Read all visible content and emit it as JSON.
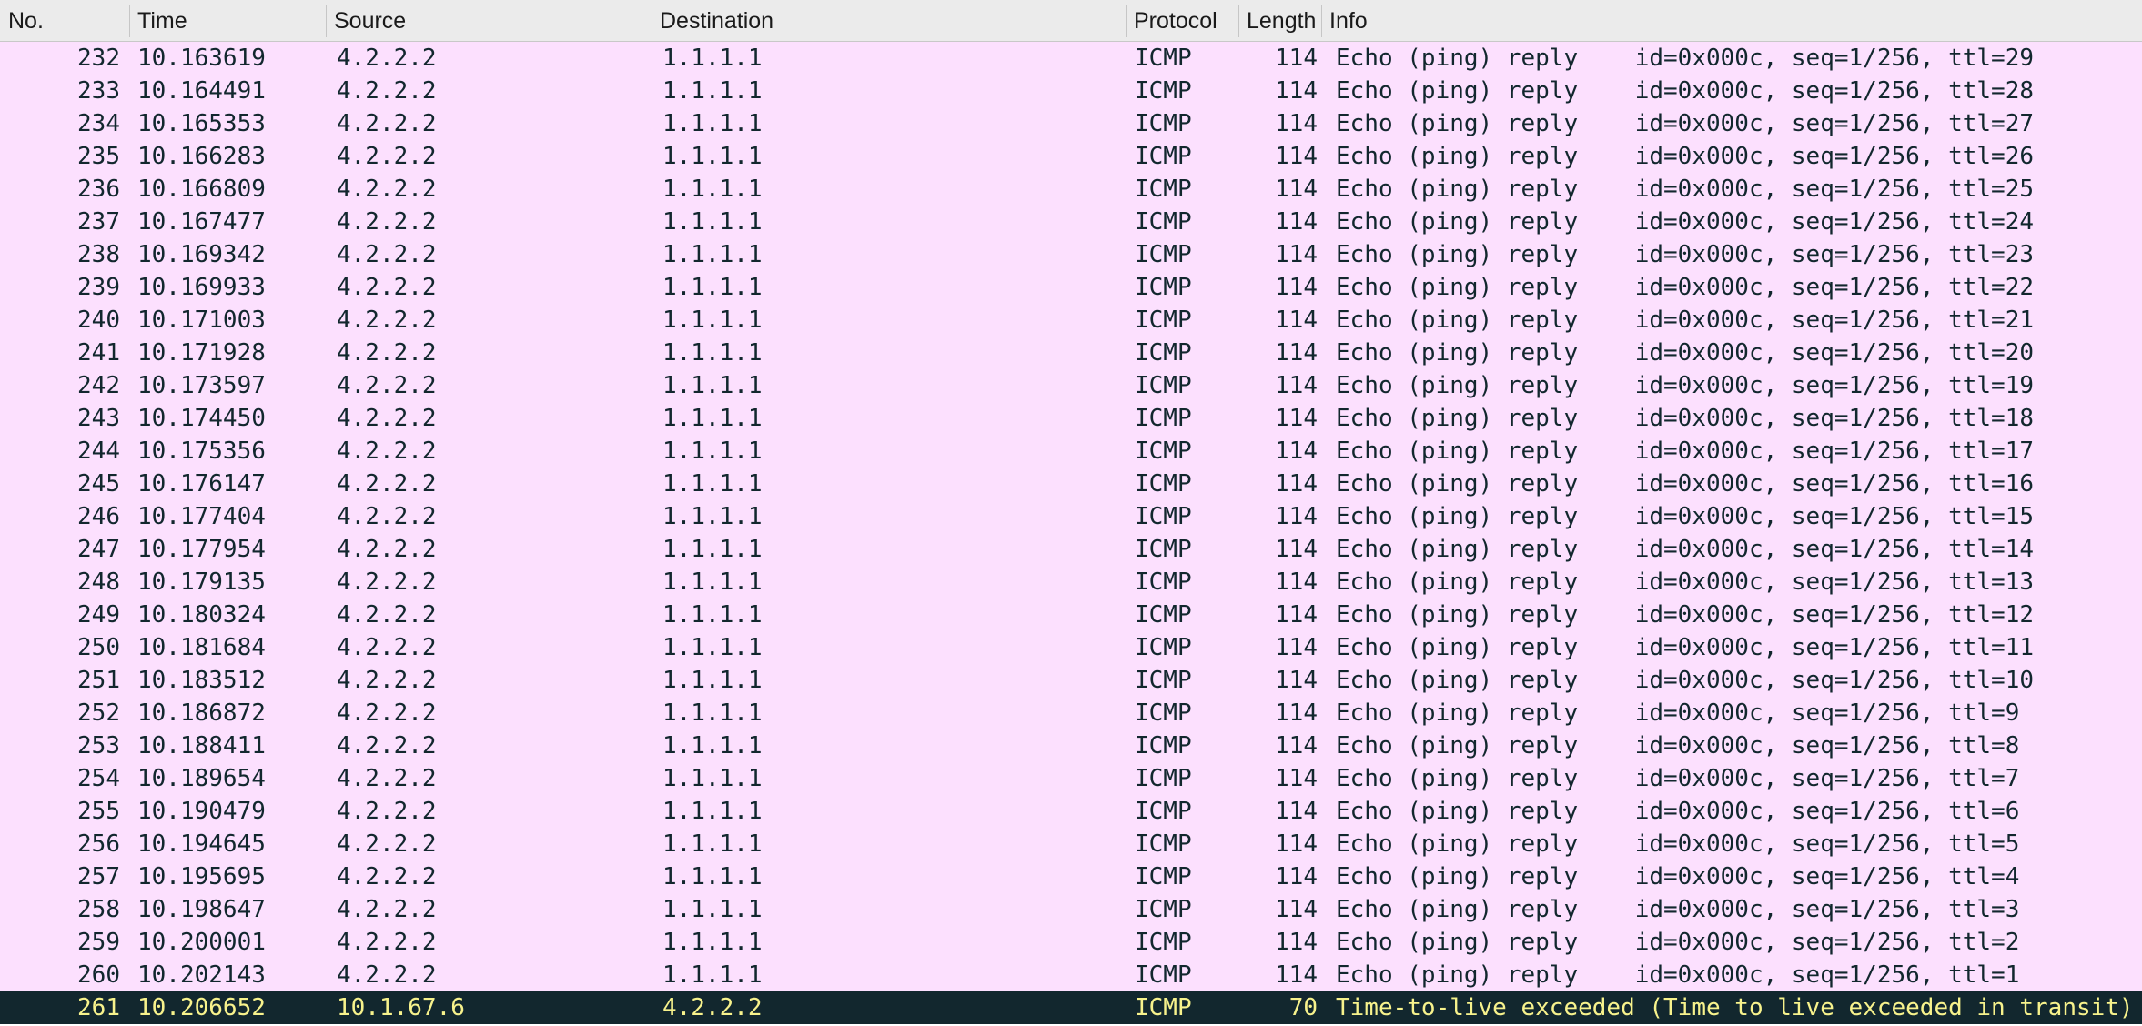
{
  "columns": {
    "no": "No.",
    "time": "Time",
    "source": "Source",
    "destination": "Destination",
    "protocol": "Protocol",
    "length": "Length",
    "info": "Info"
  },
  "colors": {
    "icmp_row_bg": "#fce0fe",
    "icmp_row_fg": "#12272e",
    "error_row_bg": "#12272e",
    "error_row_fg": "#f7f28c"
  },
  "packets": [
    {
      "no": "232",
      "time": "10.163619",
      "source": "4.2.2.2",
      "destination": "1.1.1.1",
      "protocol": "ICMP",
      "length": "114",
      "info": "Echo (ping) reply    id=0x000c, seq=1/256, ttl=29"
    },
    {
      "no": "233",
      "time": "10.164491",
      "source": "4.2.2.2",
      "destination": "1.1.1.1",
      "protocol": "ICMP",
      "length": "114",
      "info": "Echo (ping) reply    id=0x000c, seq=1/256, ttl=28"
    },
    {
      "no": "234",
      "time": "10.165353",
      "source": "4.2.2.2",
      "destination": "1.1.1.1",
      "protocol": "ICMP",
      "length": "114",
      "info": "Echo (ping) reply    id=0x000c, seq=1/256, ttl=27"
    },
    {
      "no": "235",
      "time": "10.166283",
      "source": "4.2.2.2",
      "destination": "1.1.1.1",
      "protocol": "ICMP",
      "length": "114",
      "info": "Echo (ping) reply    id=0x000c, seq=1/256, ttl=26"
    },
    {
      "no": "236",
      "time": "10.166809",
      "source": "4.2.2.2",
      "destination": "1.1.1.1",
      "protocol": "ICMP",
      "length": "114",
      "info": "Echo (ping) reply    id=0x000c, seq=1/256, ttl=25"
    },
    {
      "no": "237",
      "time": "10.167477",
      "source": "4.2.2.2",
      "destination": "1.1.1.1",
      "protocol": "ICMP",
      "length": "114",
      "info": "Echo (ping) reply    id=0x000c, seq=1/256, ttl=24"
    },
    {
      "no": "238",
      "time": "10.169342",
      "source": "4.2.2.2",
      "destination": "1.1.1.1",
      "protocol": "ICMP",
      "length": "114",
      "info": "Echo (ping) reply    id=0x000c, seq=1/256, ttl=23"
    },
    {
      "no": "239",
      "time": "10.169933",
      "source": "4.2.2.2",
      "destination": "1.1.1.1",
      "protocol": "ICMP",
      "length": "114",
      "info": "Echo (ping) reply    id=0x000c, seq=1/256, ttl=22"
    },
    {
      "no": "240",
      "time": "10.171003",
      "source": "4.2.2.2",
      "destination": "1.1.1.1",
      "protocol": "ICMP",
      "length": "114",
      "info": "Echo (ping) reply    id=0x000c, seq=1/256, ttl=21"
    },
    {
      "no": "241",
      "time": "10.171928",
      "source": "4.2.2.2",
      "destination": "1.1.1.1",
      "protocol": "ICMP",
      "length": "114",
      "info": "Echo (ping) reply    id=0x000c, seq=1/256, ttl=20"
    },
    {
      "no": "242",
      "time": "10.173597",
      "source": "4.2.2.2",
      "destination": "1.1.1.1",
      "protocol": "ICMP",
      "length": "114",
      "info": "Echo (ping) reply    id=0x000c, seq=1/256, ttl=19"
    },
    {
      "no": "243",
      "time": "10.174450",
      "source": "4.2.2.2",
      "destination": "1.1.1.1",
      "protocol": "ICMP",
      "length": "114",
      "info": "Echo (ping) reply    id=0x000c, seq=1/256, ttl=18"
    },
    {
      "no": "244",
      "time": "10.175356",
      "source": "4.2.2.2",
      "destination": "1.1.1.1",
      "protocol": "ICMP",
      "length": "114",
      "info": "Echo (ping) reply    id=0x000c, seq=1/256, ttl=17"
    },
    {
      "no": "245",
      "time": "10.176147",
      "source": "4.2.2.2",
      "destination": "1.1.1.1",
      "protocol": "ICMP",
      "length": "114",
      "info": "Echo (ping) reply    id=0x000c, seq=1/256, ttl=16"
    },
    {
      "no": "246",
      "time": "10.177404",
      "source": "4.2.2.2",
      "destination": "1.1.1.1",
      "protocol": "ICMP",
      "length": "114",
      "info": "Echo (ping) reply    id=0x000c, seq=1/256, ttl=15"
    },
    {
      "no": "247",
      "time": "10.177954",
      "source": "4.2.2.2",
      "destination": "1.1.1.1",
      "protocol": "ICMP",
      "length": "114",
      "info": "Echo (ping) reply    id=0x000c, seq=1/256, ttl=14"
    },
    {
      "no": "248",
      "time": "10.179135",
      "source": "4.2.2.2",
      "destination": "1.1.1.1",
      "protocol": "ICMP",
      "length": "114",
      "info": "Echo (ping) reply    id=0x000c, seq=1/256, ttl=13"
    },
    {
      "no": "249",
      "time": "10.180324",
      "source": "4.2.2.2",
      "destination": "1.1.1.1",
      "protocol": "ICMP",
      "length": "114",
      "info": "Echo (ping) reply    id=0x000c, seq=1/256, ttl=12"
    },
    {
      "no": "250",
      "time": "10.181684",
      "source": "4.2.2.2",
      "destination": "1.1.1.1",
      "protocol": "ICMP",
      "length": "114",
      "info": "Echo (ping) reply    id=0x000c, seq=1/256, ttl=11"
    },
    {
      "no": "251",
      "time": "10.183512",
      "source": "4.2.2.2",
      "destination": "1.1.1.1",
      "protocol": "ICMP",
      "length": "114",
      "info": "Echo (ping) reply    id=0x000c, seq=1/256, ttl=10"
    },
    {
      "no": "252",
      "time": "10.186872",
      "source": "4.2.2.2",
      "destination": "1.1.1.1",
      "protocol": "ICMP",
      "length": "114",
      "info": "Echo (ping) reply    id=0x000c, seq=1/256, ttl=9"
    },
    {
      "no": "253",
      "time": "10.188411",
      "source": "4.2.2.2",
      "destination": "1.1.1.1",
      "protocol": "ICMP",
      "length": "114",
      "info": "Echo (ping) reply    id=0x000c, seq=1/256, ttl=8"
    },
    {
      "no": "254",
      "time": "10.189654",
      "source": "4.2.2.2",
      "destination": "1.1.1.1",
      "protocol": "ICMP",
      "length": "114",
      "info": "Echo (ping) reply    id=0x000c, seq=1/256, ttl=7"
    },
    {
      "no": "255",
      "time": "10.190479",
      "source": "4.2.2.2",
      "destination": "1.1.1.1",
      "protocol": "ICMP",
      "length": "114",
      "info": "Echo (ping) reply    id=0x000c, seq=1/256, ttl=6"
    },
    {
      "no": "256",
      "time": "10.194645",
      "source": "4.2.2.2",
      "destination": "1.1.1.1",
      "protocol": "ICMP",
      "length": "114",
      "info": "Echo (ping) reply    id=0x000c, seq=1/256, ttl=5"
    },
    {
      "no": "257",
      "time": "10.195695",
      "source": "4.2.2.2",
      "destination": "1.1.1.1",
      "protocol": "ICMP",
      "length": "114",
      "info": "Echo (ping) reply    id=0x000c, seq=1/256, ttl=4"
    },
    {
      "no": "258",
      "time": "10.198647",
      "source": "4.2.2.2",
      "destination": "1.1.1.1",
      "protocol": "ICMP",
      "length": "114",
      "info": "Echo (ping) reply    id=0x000c, seq=1/256, ttl=3"
    },
    {
      "no": "259",
      "time": "10.200001",
      "source": "4.2.2.2",
      "destination": "1.1.1.1",
      "protocol": "ICMP",
      "length": "114",
      "info": "Echo (ping) reply    id=0x000c, seq=1/256, ttl=2"
    },
    {
      "no": "260",
      "time": "10.202143",
      "source": "4.2.2.2",
      "destination": "1.1.1.1",
      "protocol": "ICMP",
      "length": "114",
      "info": "Echo (ping) reply    id=0x000c, seq=1/256, ttl=1"
    },
    {
      "no": "261",
      "time": "10.206652",
      "source": "10.1.67.6",
      "destination": "4.2.2.2",
      "protocol": "ICMP",
      "length": "70",
      "info": "Time-to-live exceeded (Time to live exceeded in transit)",
      "error": true
    }
  ]
}
